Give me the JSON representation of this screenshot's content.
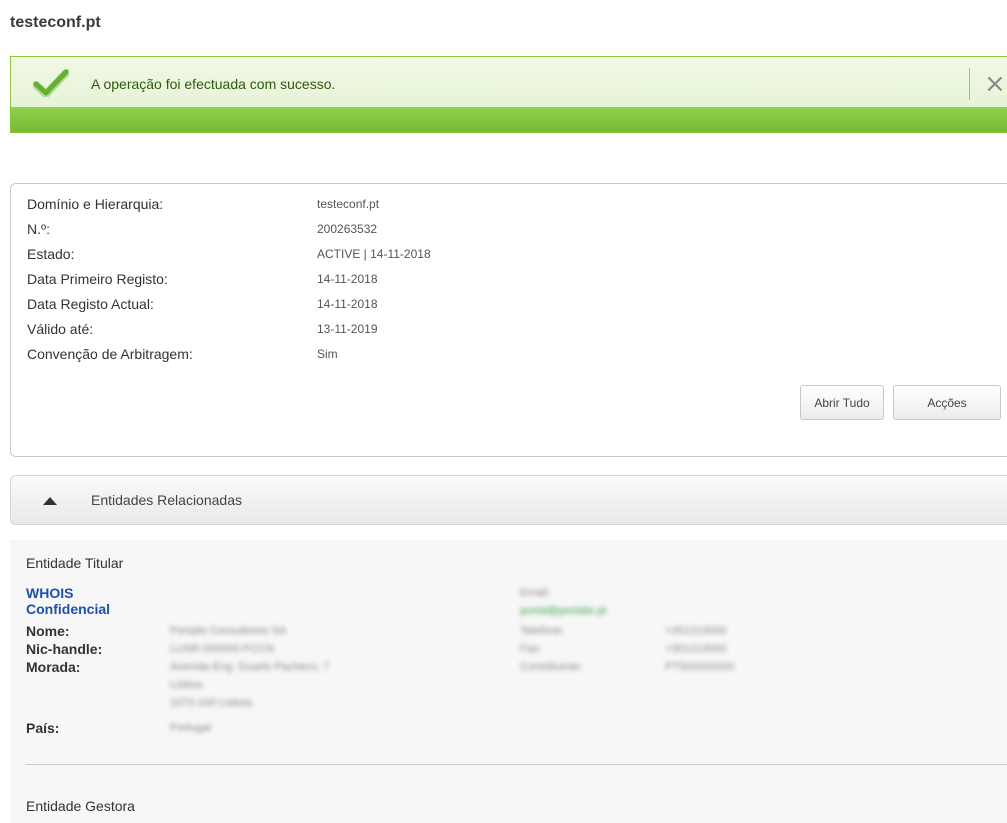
{
  "site": {
    "title": "testeconf.pt"
  },
  "banner": {
    "message": "A operação foi efectuada com sucesso.",
    "close_symbol": "×"
  },
  "info": {
    "rows": [
      {
        "label": "Domínio e Hierarquia:",
        "value": "testeconf.pt"
      },
      {
        "label": "N.º:",
        "value": "200263532"
      },
      {
        "label": "Estado:",
        "value": "ACTIVE | 14-11-2018"
      },
      {
        "label": "Data Primeiro Registo:",
        "value": "14-11-2018"
      },
      {
        "label": "Data Registo Actual:",
        "value": "14-11-2018"
      },
      {
        "label": "Válido até:",
        "value": "13-11-2019"
      },
      {
        "label": "Convenção de Arbitragem:",
        "value": "Sim"
      }
    ],
    "buttons": {
      "open_all": "Abrir Tudo",
      "actions": "Acções"
    }
  },
  "section": {
    "title": "Entidades Relacionadas",
    "holder": {
      "title": "Entidade Titular",
      "whois_line1": "WHOIS",
      "whois_line2": "Confidencial",
      "labels": {
        "name": "Nome:",
        "nic": "Nic-handle:",
        "address": "Morada:",
        "country": "País:"
      },
      "blurred": {
        "name": "Portalis Consultores SA",
        "nic": "LUSR-000000-FCCN",
        "address1": "Avenida Eng. Duarte Pacheco, 7",
        "address2": "Lisboa",
        "address3": "1070-100 Lisboa",
        "country": "Portugal",
        "email_label": "Email:",
        "email": "portal@portalis.pt",
        "phone_label": "Telefone:",
        "phone": "+351213000",
        "fax_label": "Fax:",
        "fax": "+351213000",
        "vat_label": "Contribuinte:",
        "vat": "PT500000000"
      }
    },
    "manager": {
      "title": "Entidade Gestora"
    }
  },
  "colors": {
    "success_green": "#76bb33",
    "link_blue": "#1c4fb4"
  },
  "icons": {
    "banner": "checkmark-icon",
    "close": "close-icon",
    "toggle": "triangle-up-icon"
  }
}
